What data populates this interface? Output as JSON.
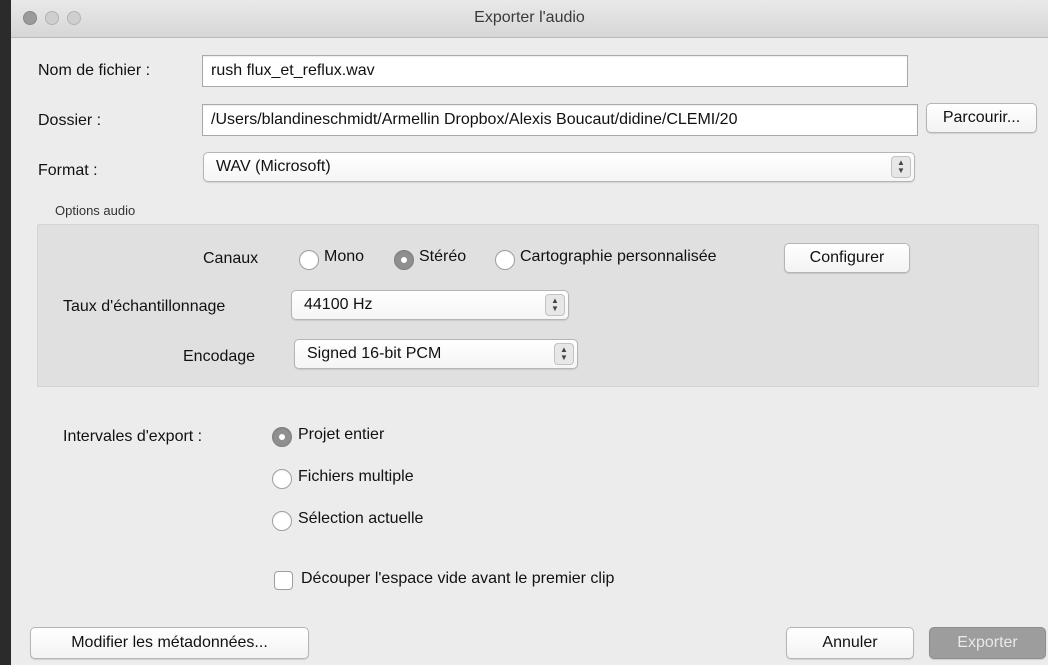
{
  "window": {
    "title": "Exporter l'audio"
  },
  "file": {
    "name_label": "Nom de fichier :",
    "name_value": "rush flux_et_reflux.wav",
    "folder_label": "Dossier :",
    "folder_value": "/Users/blandineschmidt/Armellin Dropbox/Alexis Boucaut/didine/CLEMI/20",
    "browse_label": "Parcourir...",
    "format_label": "Format :",
    "format_value": "WAV (Microsoft)"
  },
  "audio_options": {
    "section_label": "Options audio",
    "channels_label": "Canaux",
    "channels": [
      {
        "label": "Mono",
        "selected": false
      },
      {
        "label": "Stéréo",
        "selected": true
      },
      {
        "label": "Cartographie personnalisée",
        "selected": false
      }
    ],
    "configure_label": "Configurer",
    "sample_rate_label": "Taux d'échantillonnage",
    "sample_rate_value": "44100 Hz",
    "encoding_label": "Encodage",
    "encoding_value": "Signed 16-bit PCM"
  },
  "export_range": {
    "label": "Intervales d'export :",
    "options": [
      {
        "label": "Projet entier",
        "selected": true
      },
      {
        "label": "Fichiers multiple",
        "selected": false
      },
      {
        "label": "Sélection actuelle",
        "selected": false
      }
    ],
    "trim_label": "Découper l'espace vide avant le premier clip",
    "trim_checked": false
  },
  "footer": {
    "metadata_label": "Modifier les métadonnées...",
    "cancel_label": "Annuler",
    "export_label": "Exporter"
  },
  "colors": {
    "dialog_bg": "#ececec",
    "panel_bg": "#e0e0e0",
    "disabled_button": "#9d9d9d"
  }
}
